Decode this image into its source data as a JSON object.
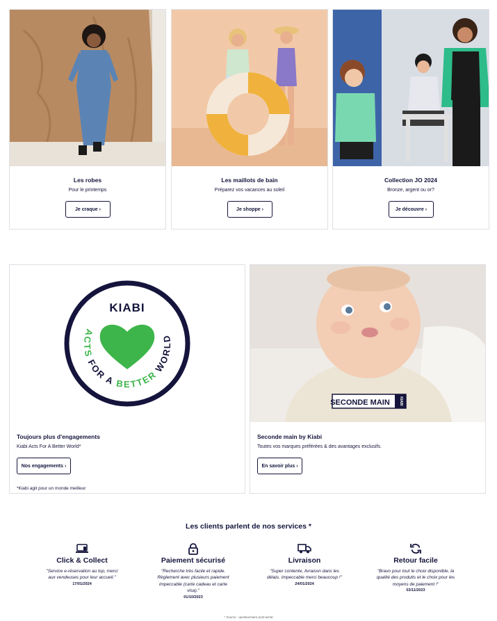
{
  "cards": [
    {
      "title": "Les robes",
      "subtitle": "Pour le printemps",
      "button": "Je craque ›"
    },
    {
      "title": "Les maillots de bain",
      "subtitle": "Préparez vos vacances au soleil",
      "button": "Je shoppe ›"
    },
    {
      "title": "Collection JO 2024",
      "subtitle": "Bronze, argent ou or?",
      "button": "Je découvre ›"
    }
  ],
  "engagement": {
    "logo_brand": "KIABI",
    "logo_ring": "ACTS FOR A BETTER WORLD",
    "title": "Toujours plus d'engagements",
    "subtitle": "Kiabi Acts For A Better World*",
    "button": "Nos engagements ›",
    "note": "*Kiabi agit pour un monde meilleur"
  },
  "second_hand": {
    "badge": "SECONDE MAIN",
    "badge_brand": "KIABI",
    "title": "Seconde main by Kiabi",
    "subtitle": "Toutes vos marques préférées & des avantages exclusifs.",
    "button": "En savoir plus ›"
  },
  "reviews": {
    "title": "Les clients parlent de nos services *",
    "items": [
      {
        "icon": "laptop-icon",
        "name": "Click & Collect",
        "quote": "\"Service e-réservation au top, merci aux vendeuses pour leur accueil.\"",
        "date": "17/01/2024"
      },
      {
        "icon": "lock-icon",
        "name": "Paiement sécurisé",
        "quote": "\"Recherche très facile et rapide. Règlement avec plusieurs paiement impeccable (carte cadeau et carte visa).\"",
        "date": "01/10/2023"
      },
      {
        "icon": "truck-icon",
        "name": "Livraison",
        "quote": "\"Super contente, livraison dans les délais. Impeccable merci beaucoup !\"",
        "date": "24/01/2024"
      },
      {
        "icon": "refresh-icon",
        "name": "Retour facile",
        "quote": "\"Bravo pour tout le choix disponible, la qualité des produits et le choix pour les moyens de paiement !\"",
        "date": "03/11/2023"
      }
    ],
    "source": "* Source : questionnaire post-achat"
  },
  "colors": {
    "navy": "#14143c",
    "kiabi_green": "#3db54a"
  }
}
